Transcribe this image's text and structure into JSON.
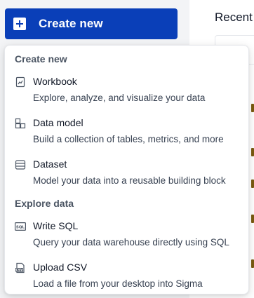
{
  "header": {
    "create_button_label": "Create new",
    "recent_label": "Recent"
  },
  "menu": {
    "sections": [
      {
        "title": "Create new",
        "items": [
          {
            "icon": "workbook-icon",
            "title": "Workbook",
            "description": "Explore, analyze, and visualize your data"
          },
          {
            "icon": "data-model-icon",
            "title": "Data model",
            "description": "Build a collection of tables, metrics, and more"
          },
          {
            "icon": "dataset-icon",
            "title": "Dataset",
            "description": "Model your data into a reusable building block"
          }
        ]
      },
      {
        "title": "Explore data",
        "items": [
          {
            "icon": "sql-icon",
            "title": "Write SQL",
            "description": "Query your data warehouse directly using SQL"
          },
          {
            "icon": "csv-icon",
            "title": "Upload CSV",
            "description": "Load a file from your desktop into Sigma"
          }
        ]
      }
    ]
  },
  "colors": {
    "primary_button": "#0a3fb8",
    "menu_background": "#ffffff"
  }
}
